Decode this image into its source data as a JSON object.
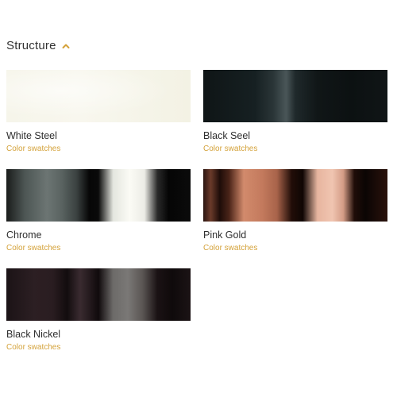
{
  "section": {
    "title": "Structure",
    "toggle_icon": "chevron-up-icon",
    "accent_color": "#d4a23a"
  },
  "swatches": [
    {
      "name": "White Steel",
      "link": "Color swatches",
      "style": "white"
    },
    {
      "name": "Black Seel",
      "link": "Color swatches",
      "style": "black"
    },
    {
      "name": "Chrome",
      "link": "Color swatches",
      "style": "chrome"
    },
    {
      "name": "Pink Gold",
      "link": "Color swatches",
      "style": "pinkgold"
    },
    {
      "name": "Black Nickel",
      "link": "Color swatches",
      "style": "blacknickel"
    }
  ]
}
